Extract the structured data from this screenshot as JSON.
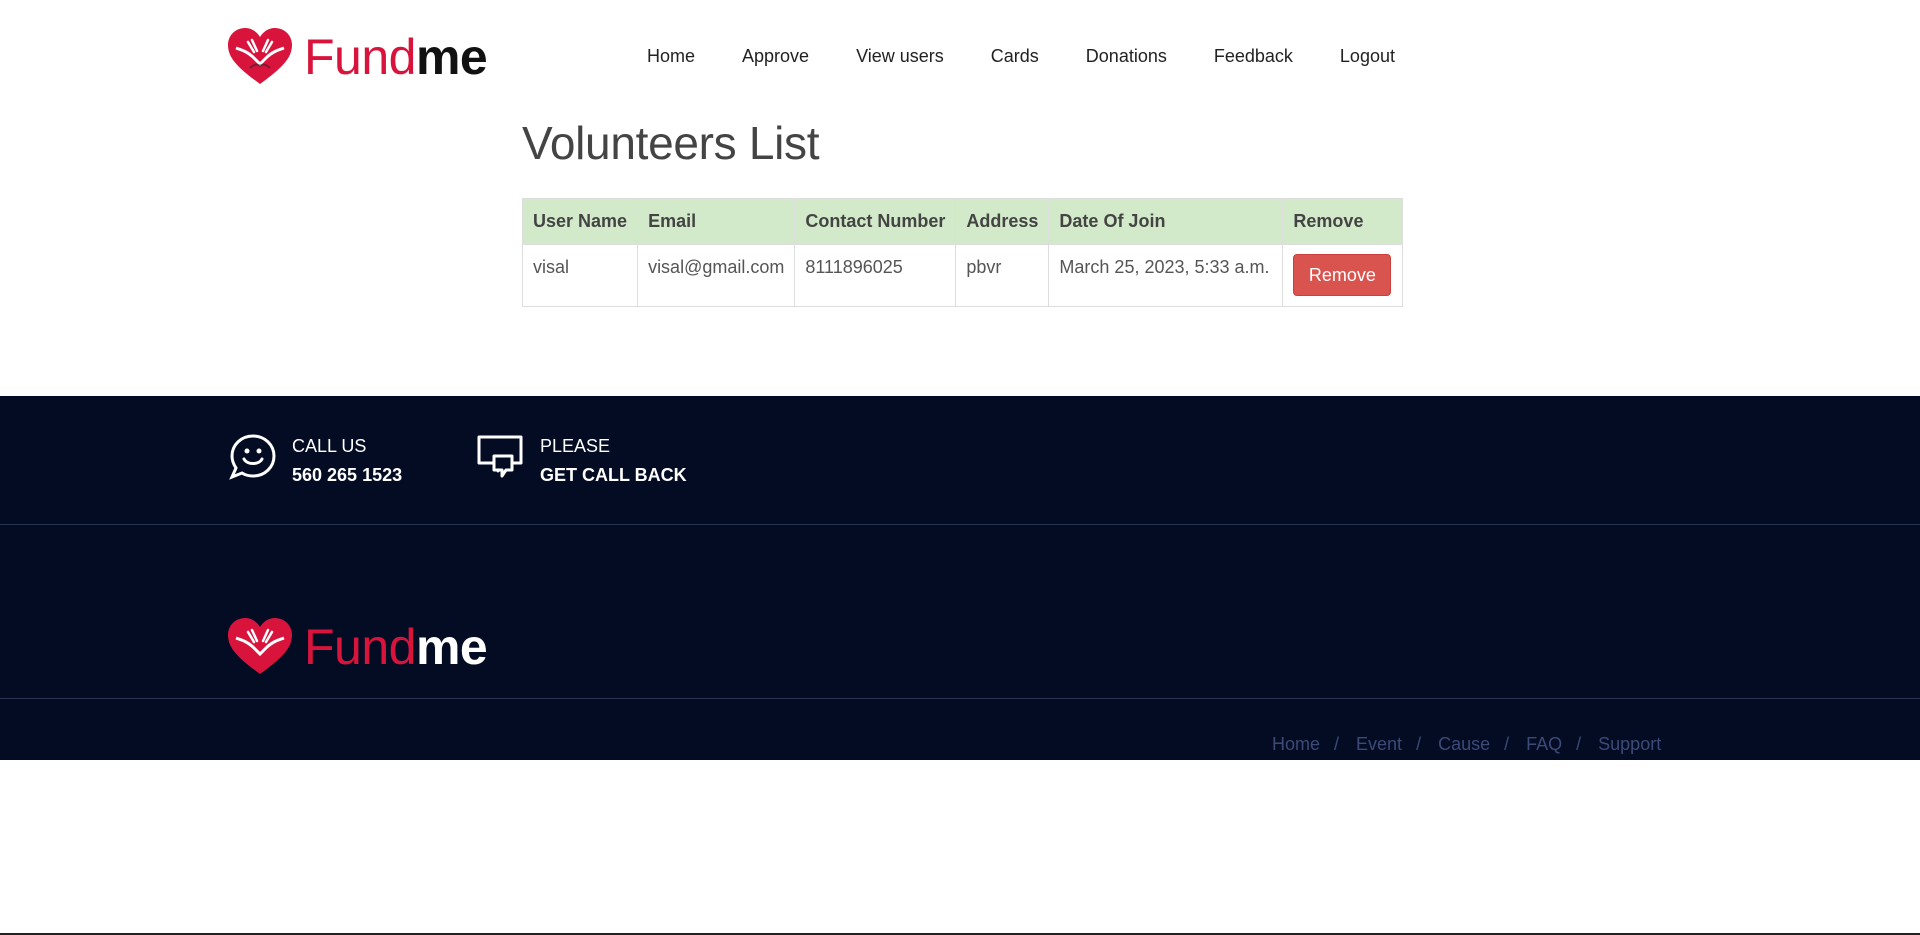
{
  "brand": {
    "name_part1": "Fund",
    "name_part2": "me",
    "accent_color": "#d9143c"
  },
  "nav": {
    "items": [
      {
        "label": "Home"
      },
      {
        "label": "Approve"
      },
      {
        "label": "View users"
      },
      {
        "label": "Cards"
      },
      {
        "label": "Donations"
      },
      {
        "label": "Feedback"
      },
      {
        "label": "Logout"
      }
    ]
  },
  "main": {
    "title": "Volunteers List",
    "table": {
      "columns": [
        "User Name",
        "Email",
        "Contact Number",
        "Address",
        "Date Of Join",
        "Remove"
      ],
      "rows": [
        {
          "user_name": "visal",
          "email": "visal@gmail.com",
          "contact": "8111896025",
          "address": "pbvr",
          "date_of_join": "March 25, 2023, 5:33 a.m.",
          "action_label": "Remove"
        }
      ],
      "header_bg": "#d2eac9",
      "button_color": "#d9534f"
    }
  },
  "footer": {
    "background": "#040c24",
    "call": {
      "icon": "smiley-chat-icon",
      "line1": "CALL US",
      "line2": "560 265 1523"
    },
    "callback": {
      "icon": "chat-bubbles-icon",
      "line1": "PLEASE",
      "line2": "GET CALL BACK"
    },
    "links": [
      {
        "label": "Home"
      },
      {
        "label": "Event"
      },
      {
        "label": "Cause"
      },
      {
        "label": "FAQ"
      },
      {
        "label": "Support"
      }
    ],
    "separator": "/"
  }
}
